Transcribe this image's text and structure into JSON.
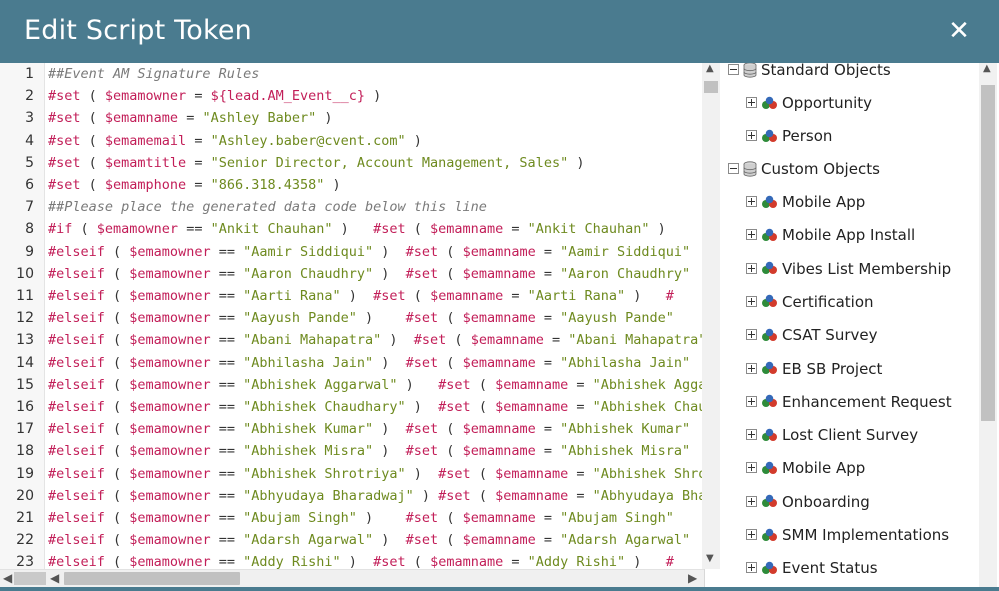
{
  "dialog": {
    "title": "Edit Script Token",
    "close_glyph": "✕"
  },
  "editor": {
    "lines": [
      {
        "n": "1",
        "parts": [
          [
            "cmt",
            "##Event AM Signature Rules"
          ]
        ]
      },
      {
        "n": "2",
        "parts": [
          [
            "kw",
            "#set"
          ],
          [
            "op",
            " ( "
          ],
          [
            "var",
            "$emamowner"
          ],
          [
            "op",
            " = "
          ],
          [
            "var",
            "${lead.AM_Event__c}"
          ],
          [
            "op",
            " )"
          ]
        ]
      },
      {
        "n": "3",
        "parts": [
          [
            "kw",
            "#set"
          ],
          [
            "op",
            " ( "
          ],
          [
            "var",
            "$emamname"
          ],
          [
            "op",
            " = "
          ],
          [
            "str",
            "\"Ashley Baber\""
          ],
          [
            "op",
            " )"
          ]
        ]
      },
      {
        "n": "4",
        "parts": [
          [
            "kw",
            "#set"
          ],
          [
            "op",
            " ( "
          ],
          [
            "var",
            "$emamemail"
          ],
          [
            "op",
            " = "
          ],
          [
            "str",
            "\"Ashley.baber@cvent.com\""
          ],
          [
            "op",
            " )"
          ]
        ]
      },
      {
        "n": "5",
        "parts": [
          [
            "kw",
            "#set"
          ],
          [
            "op",
            " ( "
          ],
          [
            "var",
            "$emamtitle"
          ],
          [
            "op",
            " = "
          ],
          [
            "str",
            "\"Senior Director, Account Management, Sales\""
          ],
          [
            "op",
            " )"
          ]
        ]
      },
      {
        "n": "6",
        "parts": [
          [
            "kw",
            "#set"
          ],
          [
            "op",
            " ( "
          ],
          [
            "var",
            "$emamphone"
          ],
          [
            "op",
            " = "
          ],
          [
            "str",
            "\"866.318.4358\""
          ],
          [
            "op",
            " )"
          ]
        ]
      },
      {
        "n": "7",
        "parts": [
          [
            "cmt",
            "##Please place the generated data code below this line"
          ]
        ]
      },
      {
        "n": "8",
        "parts": [
          [
            "kw",
            "#if"
          ],
          [
            "op",
            " ( "
          ],
          [
            "var",
            "$emamowner"
          ],
          [
            "op",
            " == "
          ],
          [
            "str",
            "\"Ankit Chauhan\""
          ],
          [
            "op",
            " )   "
          ],
          [
            "kw",
            "#set"
          ],
          [
            "op",
            " ( "
          ],
          [
            "var",
            "$emamname"
          ],
          [
            "op",
            " = "
          ],
          [
            "str",
            "\"Ankit Chauhan\""
          ],
          [
            "op",
            " )"
          ]
        ]
      },
      {
        "n": "9",
        "parts": [
          [
            "kw",
            "#elseif"
          ],
          [
            "op",
            " ( "
          ],
          [
            "var",
            "$emamowner"
          ],
          [
            "op",
            " == "
          ],
          [
            "str",
            "\"Aamir Siddiqui\""
          ],
          [
            "op",
            " )  "
          ],
          [
            "kw",
            "#set"
          ],
          [
            "op",
            " ( "
          ],
          [
            "var",
            "$emamname"
          ],
          [
            "op",
            " = "
          ],
          [
            "str",
            "\"Aamir Siddiqui\""
          ]
        ]
      },
      {
        "n": "10",
        "parts": [
          [
            "kw",
            "#elseif"
          ],
          [
            "op",
            " ( "
          ],
          [
            "var",
            "$emamowner"
          ],
          [
            "op",
            " == "
          ],
          [
            "str",
            "\"Aaron Chaudhry\""
          ],
          [
            "op",
            " )  "
          ],
          [
            "kw",
            "#set"
          ],
          [
            "op",
            " ( "
          ],
          [
            "var",
            "$emamname"
          ],
          [
            "op",
            " = "
          ],
          [
            "str",
            "\"Aaron Chaudhry\""
          ]
        ]
      },
      {
        "n": "11",
        "parts": [
          [
            "kw",
            "#elseif"
          ],
          [
            "op",
            " ( "
          ],
          [
            "var",
            "$emamowner"
          ],
          [
            "op",
            " == "
          ],
          [
            "str",
            "\"Aarti Rana\""
          ],
          [
            "op",
            " )  "
          ],
          [
            "kw",
            "#set"
          ],
          [
            "op",
            " ( "
          ],
          [
            "var",
            "$emamname"
          ],
          [
            "op",
            " = "
          ],
          [
            "str",
            "\"Aarti Rana\""
          ],
          [
            "op",
            " )   "
          ],
          [
            "kw",
            "#"
          ]
        ]
      },
      {
        "n": "12",
        "parts": [
          [
            "kw",
            "#elseif"
          ],
          [
            "op",
            " ( "
          ],
          [
            "var",
            "$emamowner"
          ],
          [
            "op",
            " == "
          ],
          [
            "str",
            "\"Aayush Pande\""
          ],
          [
            "op",
            " )    "
          ],
          [
            "kw",
            "#set"
          ],
          [
            "op",
            " ( "
          ],
          [
            "var",
            "$emamname"
          ],
          [
            "op",
            " = "
          ],
          [
            "str",
            "\"Aayush Pande\""
          ]
        ]
      },
      {
        "n": "13",
        "parts": [
          [
            "kw",
            "#elseif"
          ],
          [
            "op",
            " ( "
          ],
          [
            "var",
            "$emamowner"
          ],
          [
            "op",
            " == "
          ],
          [
            "str",
            "\"Abani Mahapatra\""
          ],
          [
            "op",
            " )  "
          ],
          [
            "kw",
            "#set"
          ],
          [
            "op",
            " ( "
          ],
          [
            "var",
            "$emamname"
          ],
          [
            "op",
            " = "
          ],
          [
            "str",
            "\"Abani Mahapatra\""
          ]
        ]
      },
      {
        "n": "14",
        "parts": [
          [
            "kw",
            "#elseif"
          ],
          [
            "op",
            " ( "
          ],
          [
            "var",
            "$emamowner"
          ],
          [
            "op",
            " == "
          ],
          [
            "str",
            "\"Abhilasha Jain\""
          ],
          [
            "op",
            " )  "
          ],
          [
            "kw",
            "#set"
          ],
          [
            "op",
            " ( "
          ],
          [
            "var",
            "$emamname"
          ],
          [
            "op",
            " = "
          ],
          [
            "str",
            "\"Abhilasha Jain\""
          ]
        ]
      },
      {
        "n": "15",
        "parts": [
          [
            "kw",
            "#elseif"
          ],
          [
            "op",
            " ( "
          ],
          [
            "var",
            "$emamowner"
          ],
          [
            "op",
            " == "
          ],
          [
            "str",
            "\"Abhishek Aggarwal\""
          ],
          [
            "op",
            " )   "
          ],
          [
            "kw",
            "#set"
          ],
          [
            "op",
            " ( "
          ],
          [
            "var",
            "$emamname"
          ],
          [
            "op",
            " = "
          ],
          [
            "str",
            "\"Abhishek Aggarwal\""
          ]
        ]
      },
      {
        "n": "16",
        "parts": [
          [
            "kw",
            "#elseif"
          ],
          [
            "op",
            " ( "
          ],
          [
            "var",
            "$emamowner"
          ],
          [
            "op",
            " == "
          ],
          [
            "str",
            "\"Abhishek Chaudhary\""
          ],
          [
            "op",
            " )  "
          ],
          [
            "kw",
            "#set"
          ],
          [
            "op",
            " ( "
          ],
          [
            "var",
            "$emamname"
          ],
          [
            "op",
            " = "
          ],
          [
            "str",
            "\"Abhishek Chaudhary\""
          ]
        ]
      },
      {
        "n": "17",
        "parts": [
          [
            "kw",
            "#elseif"
          ],
          [
            "op",
            " ( "
          ],
          [
            "var",
            "$emamowner"
          ],
          [
            "op",
            " == "
          ],
          [
            "str",
            "\"Abhishek Kumar\""
          ],
          [
            "op",
            " )  "
          ],
          [
            "kw",
            "#set"
          ],
          [
            "op",
            " ( "
          ],
          [
            "var",
            "$emamname"
          ],
          [
            "op",
            " = "
          ],
          [
            "str",
            "\"Abhishek Kumar\""
          ]
        ]
      },
      {
        "n": "18",
        "parts": [
          [
            "kw",
            "#elseif"
          ],
          [
            "op",
            " ( "
          ],
          [
            "var",
            "$emamowner"
          ],
          [
            "op",
            " == "
          ],
          [
            "str",
            "\"Abhishek Misra\""
          ],
          [
            "op",
            " )  "
          ],
          [
            "kw",
            "#set"
          ],
          [
            "op",
            " ( "
          ],
          [
            "var",
            "$emamname"
          ],
          [
            "op",
            " = "
          ],
          [
            "str",
            "\"Abhishek Misra\""
          ]
        ]
      },
      {
        "n": "19",
        "parts": [
          [
            "kw",
            "#elseif"
          ],
          [
            "op",
            " ( "
          ],
          [
            "var",
            "$emamowner"
          ],
          [
            "op",
            " == "
          ],
          [
            "str",
            "\"Abhishek Shrotriya\""
          ],
          [
            "op",
            " )  "
          ],
          [
            "kw",
            "#set"
          ],
          [
            "op",
            " ( "
          ],
          [
            "var",
            "$emamname"
          ],
          [
            "op",
            " = "
          ],
          [
            "str",
            "\"Abhishek Shrotriya\""
          ]
        ]
      },
      {
        "n": "20",
        "parts": [
          [
            "kw",
            "#elseif"
          ],
          [
            "op",
            " ( "
          ],
          [
            "var",
            "$emamowner"
          ],
          [
            "op",
            " == "
          ],
          [
            "str",
            "\"Abhyudaya Bharadwaj\""
          ],
          [
            "op",
            " ) "
          ],
          [
            "kw",
            "#set"
          ],
          [
            "op",
            " ( "
          ],
          [
            "var",
            "$emamname"
          ],
          [
            "op",
            " = "
          ],
          [
            "str",
            "\"Abhyudaya Bharadwaj\""
          ]
        ]
      },
      {
        "n": "21",
        "parts": [
          [
            "kw",
            "#elseif"
          ],
          [
            "op",
            " ( "
          ],
          [
            "var",
            "$emamowner"
          ],
          [
            "op",
            " == "
          ],
          [
            "str",
            "\"Abujam Singh\""
          ],
          [
            "op",
            " )    "
          ],
          [
            "kw",
            "#set"
          ],
          [
            "op",
            " ( "
          ],
          [
            "var",
            "$emamname"
          ],
          [
            "op",
            " = "
          ],
          [
            "str",
            "\"Abujam Singh\""
          ]
        ]
      },
      {
        "n": "22",
        "parts": [
          [
            "kw",
            "#elseif"
          ],
          [
            "op",
            " ( "
          ],
          [
            "var",
            "$emamowner"
          ],
          [
            "op",
            " == "
          ],
          [
            "str",
            "\"Adarsh Agarwal\""
          ],
          [
            "op",
            " )  "
          ],
          [
            "kw",
            "#set"
          ],
          [
            "op",
            " ( "
          ],
          [
            "var",
            "$emamname"
          ],
          [
            "op",
            " = "
          ],
          [
            "str",
            "\"Adarsh Agarwal\""
          ]
        ]
      },
      {
        "n": "23",
        "parts": [
          [
            "kw",
            "#elseif"
          ],
          [
            "op",
            " ( "
          ],
          [
            "var",
            "$emamowner"
          ],
          [
            "op",
            " == "
          ],
          [
            "str",
            "\"Addy Rishi\""
          ],
          [
            "op",
            " )  "
          ],
          [
            "kw",
            "#set"
          ],
          [
            "op",
            " ( "
          ],
          [
            "var",
            "$emamname"
          ],
          [
            "op",
            " = "
          ],
          [
            "str",
            "\"Addy Rishi\""
          ],
          [
            "op",
            " )   "
          ],
          [
            "kw",
            "#"
          ]
        ]
      }
    ]
  },
  "tree": {
    "standard_objects_label": "Standard Objects",
    "standard_children": [
      "Opportunity",
      "Person"
    ],
    "custom_objects_label": "Custom Objects",
    "custom_children": [
      "Mobile App",
      "Mobile App Install",
      "Vibes List Membership",
      "Certification",
      "CSAT Survey",
      "EB SB Project",
      "Enhancement Request",
      "Lost Client Survey",
      "Mobile App",
      "Onboarding",
      "SMM Implementations",
      "Event Status"
    ]
  },
  "colors": {
    "header_bg": "#4a7b8f",
    "keyword": "#c21e58",
    "string": "#6e8a1f",
    "comment": "#7a7a7a"
  }
}
